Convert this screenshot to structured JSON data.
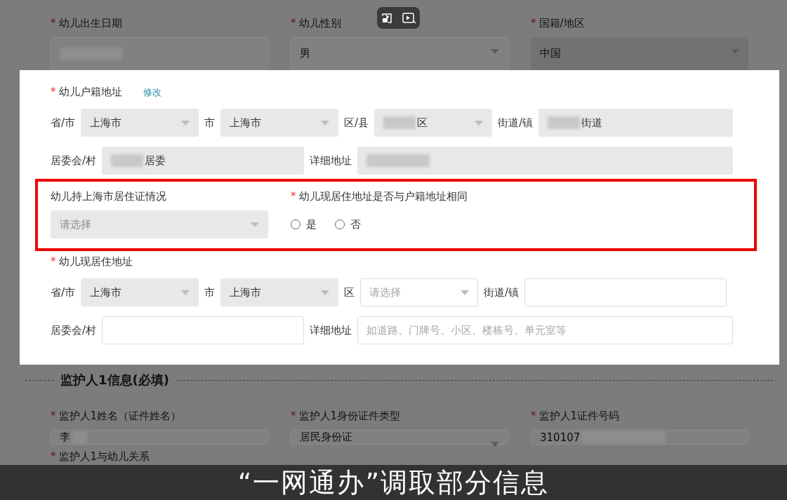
{
  "player_controls": [
    {
      "kind": "pip"
    },
    {
      "kind": "play"
    }
  ],
  "top_row": [
    {
      "label": "幼儿出生日期",
      "marker": "*",
      "kind": "input",
      "redacted_before": true
    },
    {
      "label": "幼儿性别",
      "marker": "*",
      "kind": "select",
      "value": "男"
    },
    {
      "label": "国籍/地区",
      "marker": "*",
      "kind": "select",
      "value": "中国",
      "disabled": true
    }
  ],
  "household_address": {
    "label": "幼儿户籍地址",
    "marker": "*",
    "action": "修改",
    "line1": [
      {
        "label": "省/市",
        "kind": "select",
        "value": "上海市",
        "disabled": true
      },
      {
        "label": "市",
        "kind": "select",
        "value": "上海市",
        "disabled": true
      },
      {
        "label": "区/县",
        "kind": "select",
        "value": "区",
        "redacted_before": true,
        "disabled": true
      },
      {
        "label": "街道/镇",
        "kind": "input",
        "value": "街道",
        "redacted_before": true,
        "disabled": true
      }
    ],
    "line2": [
      {
        "label": "居委会/村",
        "kind": "input",
        "value": "居委",
        "redacted_before": true,
        "disabled": true
      },
      {
        "label": "详细地址",
        "kind": "input",
        "redacted_before": true,
        "disabled": true
      }
    ]
  },
  "residence_permit": {
    "label": "幼儿持上海市居住证情况",
    "placeholder": "请选择",
    "disabled": true
  },
  "same_address": {
    "label": "幼儿现居住地址是否与户籍地址相同",
    "marker": "*",
    "options": [
      {
        "label": "是",
        "selected": false
      },
      {
        "label": "否",
        "selected": false
      }
    ]
  },
  "current_address": {
    "label": "幼儿现居住地址",
    "marker": "*",
    "line1": [
      {
        "label": "省/市",
        "kind": "select",
        "value": "上海市",
        "disabled": true
      },
      {
        "label": "市",
        "kind": "select",
        "value": "上海市",
        "disabled": true
      },
      {
        "label": "区",
        "kind": "select",
        "placeholder": "请选择",
        "disabled": false
      },
      {
        "label": "街道/镇",
        "kind": "input",
        "disabled": false
      }
    ],
    "line2": [
      {
        "label": "居委会/村",
        "kind": "input",
        "disabled": false
      },
      {
        "label": "详细地址",
        "kind": "input",
        "placeholder": "如道路、门牌号、小区、楼栋号、单元室等",
        "disabled": false
      }
    ]
  },
  "guardian_section": {
    "title": "监护人1信息(必填)",
    "fields": [
      {
        "label": "监护人1姓名（证件姓名）",
        "marker": "*",
        "kind": "input",
        "value": "李",
        "redacted_after": true
      },
      {
        "label": "监护人1身份证件类型",
        "marker": "*",
        "kind": "select",
        "value": "居民身份证"
      },
      {
        "label": "监护人1证件号码",
        "marker": "*",
        "kind": "input",
        "value": "310107",
        "redacted_after": true
      }
    ],
    "next_fields": [
      {
        "label": "监护人1与幼儿关系",
        "marker": "*"
      }
    ]
  },
  "caption": "“一网通办”调取部分信息"
}
